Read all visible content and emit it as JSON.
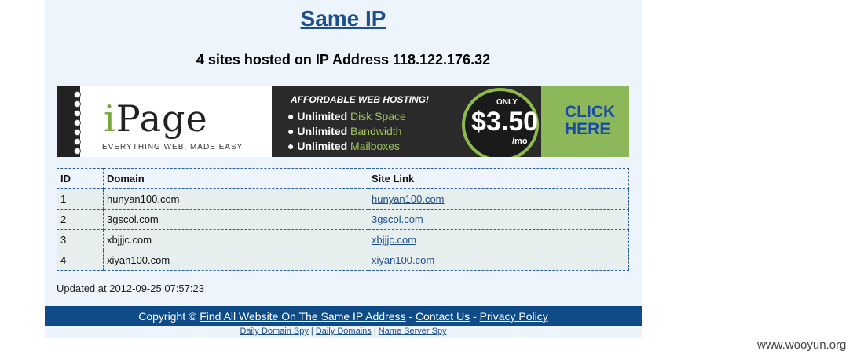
{
  "header": {
    "title": "Same IP",
    "subtitle": "4 sites hosted on IP Address 118.122.176.32"
  },
  "banner": {
    "logo_i": "i",
    "logo_rest": "Page",
    "tagline": "EVERYTHING WEB, MADE EASY.",
    "headline": "AFFORDABLE WEB HOSTING!",
    "features": [
      {
        "bold": "Unlimited",
        "rest": "Disk Space"
      },
      {
        "bold": "Unlimited",
        "rest": "Bandwidth"
      },
      {
        "bold": "Unlimited",
        "rest": "Mailboxes"
      }
    ],
    "price_only": "ONLY",
    "price": "$3.50",
    "price_unit": "/mo",
    "cta_line1": "CLICK",
    "cta_line2": "HERE",
    "accent_color": "#8cb859"
  },
  "table": {
    "headers": [
      "ID",
      "Domain",
      "Site Link"
    ],
    "rows": [
      {
        "id": "1",
        "domain": "hunyan100.com",
        "link": "hunyan100.com"
      },
      {
        "id": "2",
        "domain": "3gscol.com",
        "link": "3gscol.com"
      },
      {
        "id": "3",
        "domain": "xbjjjc.com",
        "link": "xbjjjc.com"
      },
      {
        "id": "4",
        "domain": "xiyan100.com",
        "link": "xiyan100.com"
      }
    ]
  },
  "updated": "Updated at 2012-09-25 07:57:23",
  "footer": {
    "copyright": "Copyright ©",
    "link1": "Find All Website On The Same IP Address",
    "sep1": " - ",
    "link2": "Contact Us",
    "sep2": " - ",
    "link3": "Privacy Policy",
    "sub_links": [
      "Daily Domain Spy",
      "Daily Domains",
      "Name Server Spy"
    ],
    "sub_sep": " | ",
    "bar_color": "#0f4b86"
  },
  "watermark": "www.wooyun.org"
}
